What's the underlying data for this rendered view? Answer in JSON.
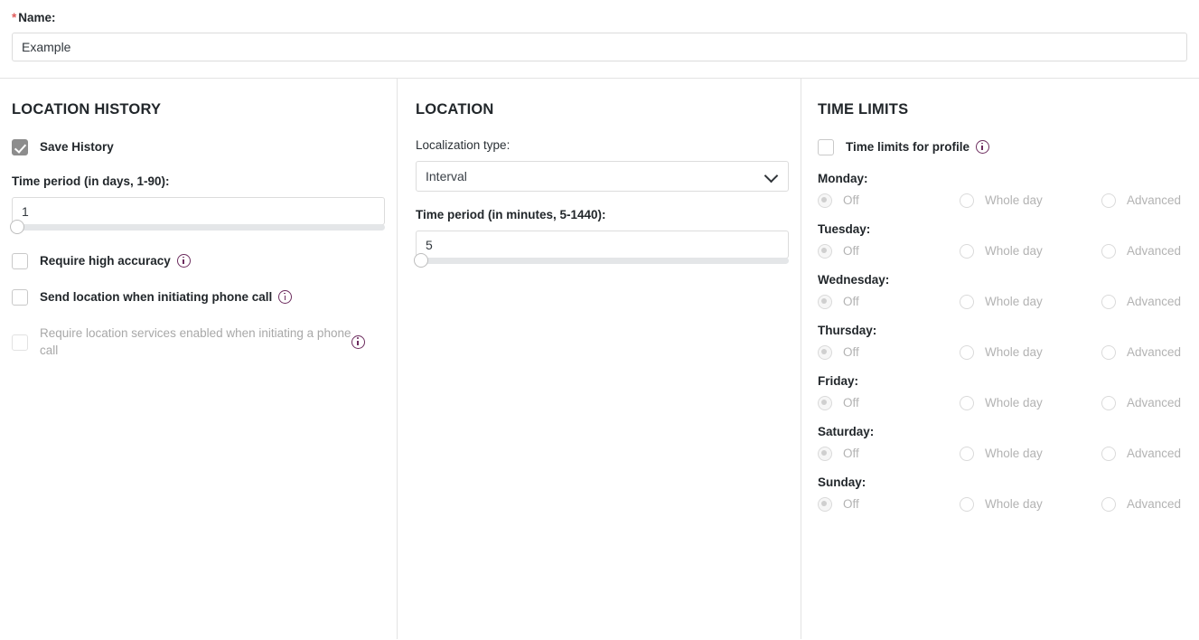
{
  "name_field": {
    "required_marker": "*",
    "label": "Name:",
    "value": "Example",
    "placeholder": ""
  },
  "location_history": {
    "title": "LOCATION HISTORY",
    "save_history_label": "Save History",
    "save_history_checked": true,
    "time_period_label": "Time period (in days, 1-90):",
    "time_period_value": "1",
    "slider_min": 1,
    "slider_max": 90,
    "slider_value": 1,
    "options": [
      {
        "label": "Require high accuracy",
        "checked": false,
        "disabled": false,
        "info": true
      },
      {
        "label": "Send location when initiating phone call",
        "checked": false,
        "disabled": false,
        "info": true
      },
      {
        "label": "Require location services enabled when initiating a phone call",
        "checked": false,
        "disabled": true,
        "info": true
      }
    ]
  },
  "location": {
    "title": "LOCATION",
    "localization_type_label": "Localization type:",
    "localization_type_value": "Interval",
    "localization_type_options": [
      "Interval"
    ],
    "time_period_label": "Time period (in minutes, 5-1440):",
    "time_period_value": "5",
    "slider_min": 5,
    "slider_max": 1440,
    "slider_value": 5
  },
  "time_limits": {
    "title": "TIME LIMITS",
    "profile_toggle_label": "Time limits for profile",
    "profile_toggle_checked": false,
    "radio_options": [
      "Off",
      "Whole day",
      "Advanced"
    ],
    "days": [
      {
        "label": "Monday:",
        "selected": "Off",
        "disabled": true
      },
      {
        "label": "Tuesday:",
        "selected": "Off",
        "disabled": true
      },
      {
        "label": "Wednesday:",
        "selected": "Off",
        "disabled": true
      },
      {
        "label": "Thursday:",
        "selected": "Off",
        "disabled": true
      },
      {
        "label": "Friday:",
        "selected": "Off",
        "disabled": true
      },
      {
        "label": "Saturday:",
        "selected": "Off",
        "disabled": true
      },
      {
        "label": "Sunday:",
        "selected": "Off",
        "disabled": true
      }
    ]
  },
  "colors": {
    "required_star": "#e05c5c",
    "info_icon": "#6c2c5e",
    "checkbox_checked_fill": "#8d8d8d",
    "divider": "#e3e3e3",
    "slider_track": "#e4e6e8",
    "disabled_text": "#b3b3b3"
  },
  "icons": {
    "info": "info-icon",
    "chevron_down": "chevron-down-icon",
    "check": "check-icon"
  }
}
